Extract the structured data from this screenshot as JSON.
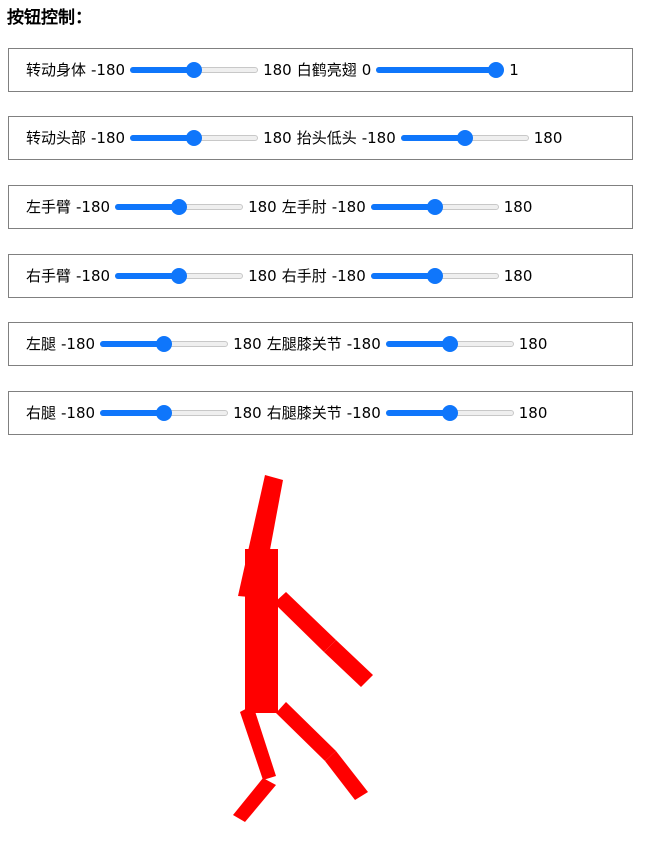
{
  "heading": "按钮控制：",
  "controls": [
    {
      "a": {
        "label": "转动身体",
        "min_label": "-180",
        "max_label": "180",
        "min": -180,
        "max": 180,
        "value": 0
      },
      "b": {
        "label": "白鹤亮翅",
        "min_label": "0",
        "max_label": "1",
        "min": 0,
        "max": 1,
        "value": 1
      }
    },
    {
      "a": {
        "label": "转动头部",
        "min_label": "-180",
        "max_label": "180",
        "min": -180,
        "max": 180,
        "value": 0
      },
      "b": {
        "label": "抬头低头",
        "min_label": "-180",
        "max_label": "180",
        "min": -180,
        "max": 180,
        "value": 0
      }
    },
    {
      "a": {
        "label": "左手臂",
        "min_label": "-180",
        "max_label": "180",
        "min": -180,
        "max": 180,
        "value": 0
      },
      "b": {
        "label": "左手肘",
        "min_label": "-180",
        "max_label": "180",
        "min": -180,
        "max": 180,
        "value": 0
      }
    },
    {
      "a": {
        "label": "右手臂",
        "min_label": "-180",
        "max_label": "180",
        "min": -180,
        "max": 180,
        "value": 0
      },
      "b": {
        "label": "右手肘",
        "min_label": "-180",
        "max_label": "180",
        "min": -180,
        "max": 180,
        "value": 0
      }
    },
    {
      "a": {
        "label": "左腿",
        "min_label": "-180",
        "max_label": "180",
        "min": -180,
        "max": 180,
        "value": 0
      },
      "b": {
        "label": "左腿膝关节",
        "min_label": "-180",
        "max_label": "180",
        "min": -180,
        "max": 180,
        "value": 0
      }
    },
    {
      "a": {
        "label": "右腿",
        "min_label": "-180",
        "max_label": "180",
        "min": -180,
        "max": 180,
        "value": 0
      },
      "b": {
        "label": "右腿膝关节",
        "min_label": "-180",
        "max_label": "180",
        "min": -180,
        "max": 180,
        "value": 0
      }
    }
  ],
  "colors": {
    "slider_accent": "#0f76fb",
    "figure": "#ff0000",
    "panel_border": "#808080"
  }
}
